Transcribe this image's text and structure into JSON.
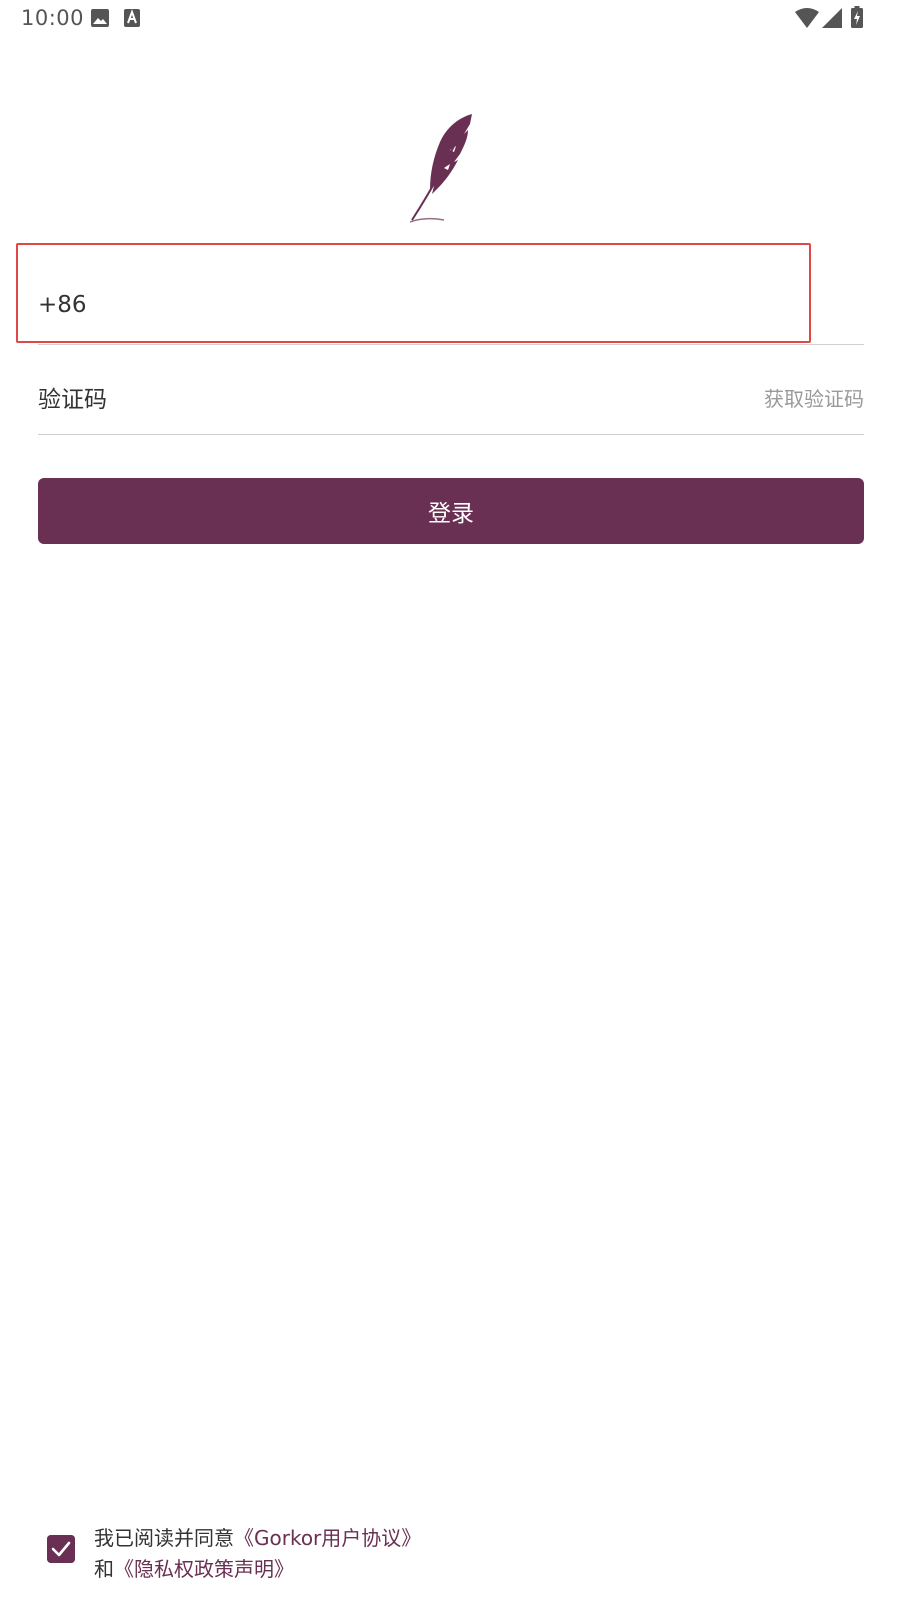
{
  "status_bar": {
    "time": "10:00",
    "left_icons": [
      "image-icon",
      "a-notification-icon"
    ],
    "right_icons": [
      "wifi-icon",
      "signal-icon",
      "battery-charging-icon"
    ]
  },
  "logo": {
    "icon": "feather-logo-icon",
    "color": "#6a3053"
  },
  "phone": {
    "prefix": "+86",
    "value": "",
    "placeholder": ""
  },
  "code": {
    "label": "验证码",
    "get_code_label": "获取验证码"
  },
  "login": {
    "label": "登录"
  },
  "agreement": {
    "checked": true,
    "prefix_text": "我已阅读并同意",
    "user_agreement": "《Gorkor用户协议》",
    "and_text": "和",
    "privacy_policy": "《隐私权政策声明》"
  },
  "colors": {
    "accent": "#6a3053",
    "highlight": "#e04848",
    "divider": "#cfcfcf"
  }
}
